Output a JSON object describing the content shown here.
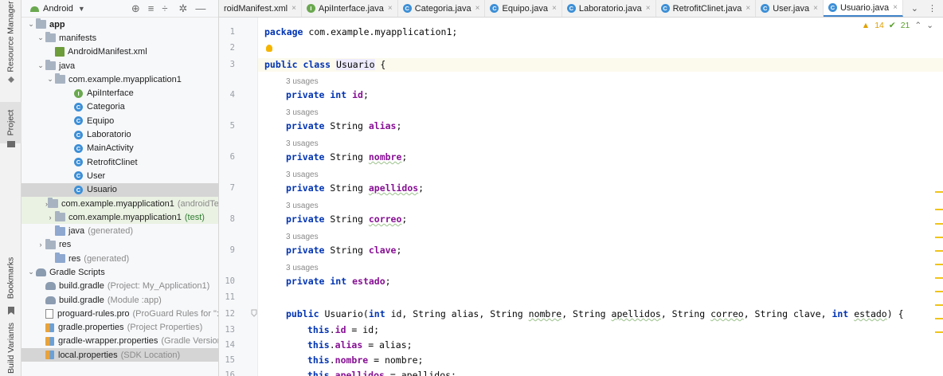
{
  "side_strip": {
    "resource_manager": "Resource Manager",
    "project": "Project",
    "bookmarks": "Bookmarks",
    "build_variants": "Build Variants"
  },
  "project_panel": {
    "view_label": "Android",
    "tree": [
      {
        "label": "app",
        "type": "module",
        "bold": true
      },
      {
        "label": "manifests",
        "type": "folder"
      },
      {
        "label": "AndroidManifest.xml",
        "type": "xml"
      },
      {
        "label": "java",
        "type": "folder"
      },
      {
        "label": "com.example.myapplication1",
        "type": "package"
      },
      {
        "label": "ApiInterface",
        "type": "interface"
      },
      {
        "label": "Categoria",
        "type": "class"
      },
      {
        "label": "Equipo",
        "type": "class"
      },
      {
        "label": "Laboratorio",
        "type": "class"
      },
      {
        "label": "MainActivity",
        "type": "class"
      },
      {
        "label": "RetrofitClinet",
        "type": "class"
      },
      {
        "label": "User",
        "type": "class"
      },
      {
        "label": "Usuario",
        "type": "class",
        "selected": true
      },
      {
        "label": "com.example.myapplication1",
        "suffix": "(androidTest)",
        "type": "package"
      },
      {
        "label": "com.example.myapplication1",
        "suffix": "(test)",
        "type": "package"
      },
      {
        "label": "java",
        "suffix": "(generated)",
        "type": "folder"
      },
      {
        "label": "res",
        "type": "folder"
      },
      {
        "label": "res",
        "suffix": "(generated)",
        "type": "folder"
      },
      {
        "label": "Gradle Scripts",
        "type": "gradle"
      },
      {
        "label": "build.gradle",
        "suffix": "(Project: My_Application1)",
        "type": "gradle-file"
      },
      {
        "label": "build.gradle",
        "suffix": "(Module :app)",
        "type": "gradle-file"
      },
      {
        "label": "proguard-rules.pro",
        "suffix": "(ProGuard Rules for \":app\")",
        "type": "file"
      },
      {
        "label": "gradle.properties",
        "suffix": "(Project Properties)",
        "type": "props"
      },
      {
        "label": "gradle-wrapper.properties",
        "suffix": "(Gradle Version)",
        "type": "props"
      },
      {
        "label": "local.properties",
        "suffix": "(SDK Location)",
        "type": "props"
      }
    ]
  },
  "tabs": [
    {
      "label": "roidManifest.xml",
      "type": "xml"
    },
    {
      "label": "ApiInterface.java",
      "type": "interface"
    },
    {
      "label": "Categoria.java",
      "type": "class"
    },
    {
      "label": "Equipo.java",
      "type": "class"
    },
    {
      "label": "Laboratorio.java",
      "type": "class"
    },
    {
      "label": "RetrofitClinet.java",
      "type": "class"
    },
    {
      "label": "User.java",
      "type": "class"
    },
    {
      "label": "Usuario.java",
      "type": "class",
      "active": true
    }
  ],
  "inspection": {
    "warnings": "14",
    "ok": "21"
  },
  "code": {
    "usage_label": "3 usages",
    "lines": [
      {
        "n": "1",
        "text": "package com.example.myapplication1;"
      },
      {
        "n": "2",
        "text": ""
      },
      {
        "n": "3",
        "text": "public class Usuario {"
      },
      {
        "n": "4",
        "text": "private int id;"
      },
      {
        "n": "5",
        "text": "private String alias;"
      },
      {
        "n": "6",
        "text": "private String nombre;"
      },
      {
        "n": "7",
        "text": "private String apellidos;"
      },
      {
        "n": "8",
        "text": "private String correo;"
      },
      {
        "n": "9",
        "text": "private String clave;"
      },
      {
        "n": "10",
        "text": "private int estado;"
      },
      {
        "n": "11",
        "text": ""
      },
      {
        "n": "12",
        "text": "public Usuario(int id, String alias, String nombre, String apellidos, String correo, String clave, int estado) {"
      },
      {
        "n": "13",
        "text": "this.id = id;"
      },
      {
        "n": "14",
        "text": "this.alias = alias;"
      },
      {
        "n": "15",
        "text": "this.nombre = nombre;"
      },
      {
        "n": "16",
        "text": "this.apellidos = apellidos;"
      }
    ]
  }
}
